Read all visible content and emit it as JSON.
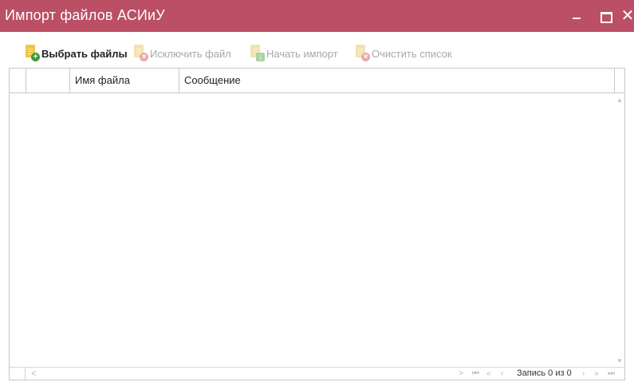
{
  "window": {
    "title": "Импорт файлов АСИиУ",
    "minimize_glyph": "–",
    "close_glyph": "✕"
  },
  "toolbar": {
    "select_files": "Выбрать файлы",
    "exclude_file": "Исключить файл",
    "start_import": "Начать импорт",
    "clear_list": "Очистить список",
    "icons": [
      "document-add-icon",
      "document-remove-icon",
      "document-import-icon",
      "document-clear-icon"
    ]
  },
  "grid": {
    "columns": [
      "",
      "",
      "Имя файла",
      "Сообщение"
    ],
    "rows": []
  },
  "pager": {
    "scroll_left": "<",
    "scroll_right": ">",
    "first": "⏮",
    "prev_page": "«",
    "prev": "‹",
    "record_text": "Запись 0 из 0",
    "next": "›",
    "next_page": "»",
    "last": "⏭"
  },
  "colors": {
    "titlebar": "#bb4f66",
    "icon_page": "#f1c64a",
    "badge_add": "#3f9a3a",
    "badge_remove": "#d9534f"
  }
}
